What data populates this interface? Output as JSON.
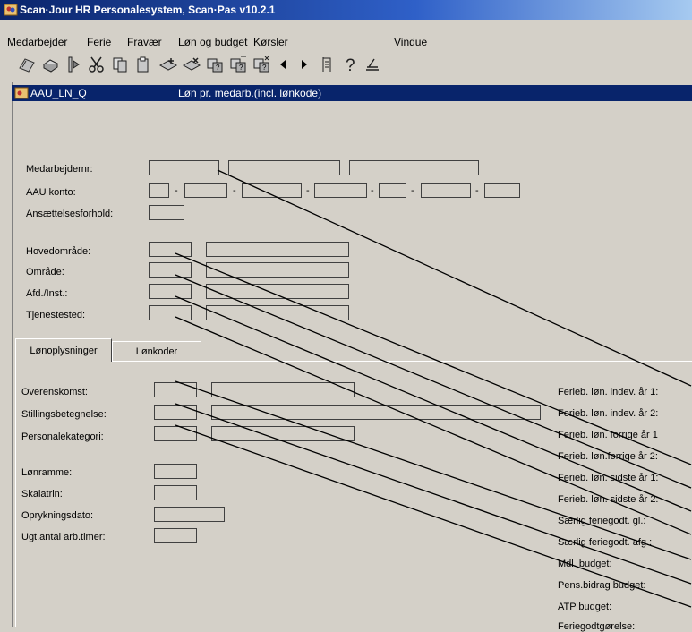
{
  "window": {
    "title": "Scan·Jour HR Personalesystem, Scan·Pas  v10.2.1"
  },
  "menu": [
    "Medarbejder",
    "Ferie",
    "Fravær",
    "Løn og budget",
    "Kørsler",
    "Vindue"
  ],
  "toolbar": [
    "open-icon",
    "print-icon",
    "preview-icon",
    "cut-icon",
    "copy-icon",
    "paste-icon",
    "add-record-icon",
    "delete-record-icon",
    "query-icon",
    "query-run-icon",
    "query-cancel-icon",
    "prev-icon",
    "next-icon",
    "report-icon",
    "help-icon",
    "exit-icon"
  ],
  "form": {
    "code": "AAU_LN_Q",
    "title": "Løn pr. medarb.(incl. lønkode)"
  },
  "header_fields": {
    "medarbejdernr": "Medarbejdernr:",
    "aau_konto": "AAU konto:",
    "ansaettelse": "Ansættelsesforhold:",
    "hovedomraade": "Hovedområde:",
    "omraade": "Område:",
    "afd": "Afd./Inst.:",
    "tjenestested": "Tjenestested:"
  },
  "tabs": [
    "Lønoplysninger",
    "Lønkoder"
  ],
  "tab_fields": {
    "overenskomst": "Overenskomst:",
    "stilling": "Stillingsbetegnelse:",
    "personalekategori": "Personalekategori:",
    "loenramme": "Lønramme:",
    "skalatrin": "Skalatrin:",
    "oprykningsdato": "Oprykningsdato:",
    "ugt_timer": "Ugt.antal arb.timer:"
  },
  "right_labels": [
    "Ferieb. løn. indev. år 1:",
    "Ferieb. løn. indev. år 2:",
    "Ferieb. løn. forrige år 1",
    "Ferieb. løn.forrige år 2:",
    "Ferieb. løn. sidste år 1:",
    "Ferieb. løn. sidste år 2:",
    "Særlig feriegodt. gl.:",
    "Særlig feriegodt. afg.:",
    "Mdl. budget:",
    "Pens.bidrag budget:",
    "ATP budget:",
    "Feriegodtgørelse:"
  ]
}
